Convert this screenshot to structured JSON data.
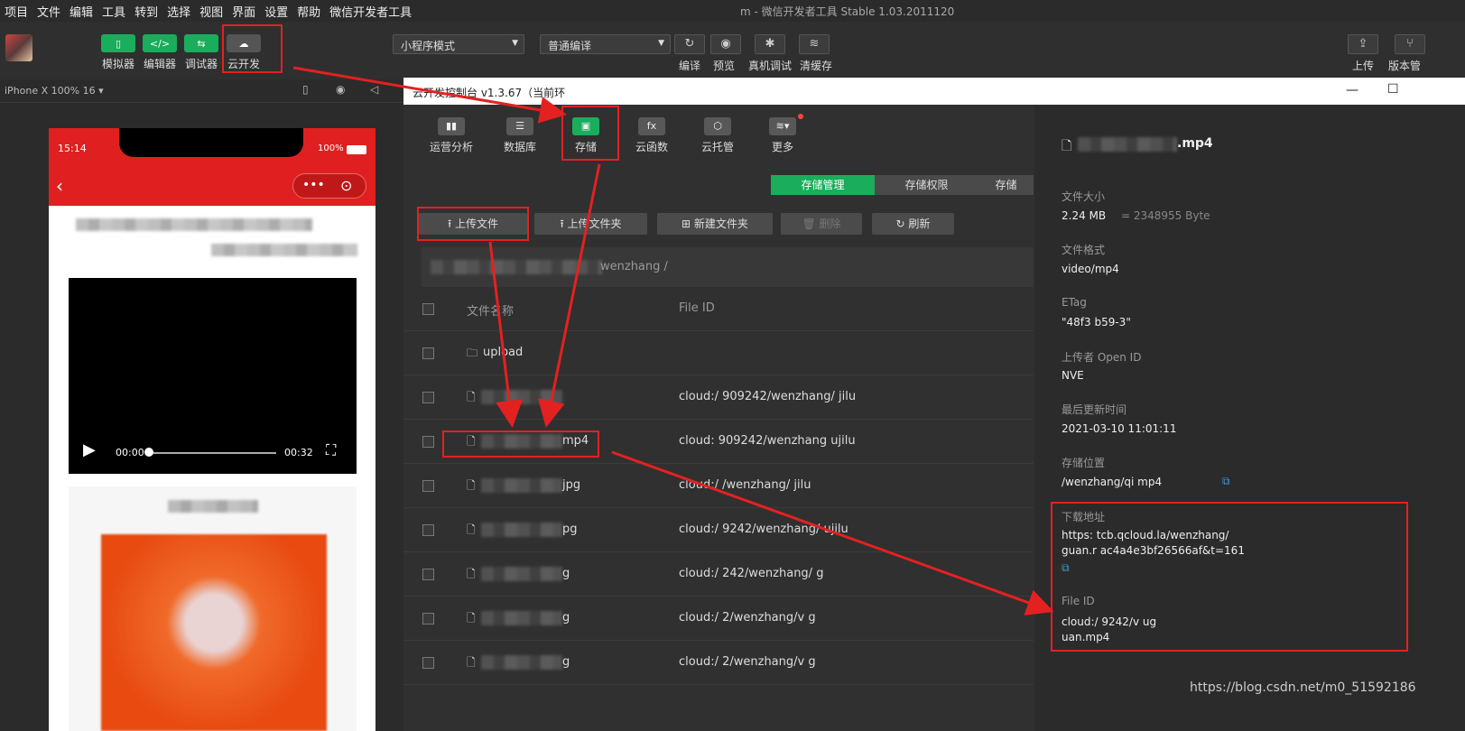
{
  "menu": [
    "项目",
    "文件",
    "编辑",
    "工具",
    "转到",
    "选择",
    "视图",
    "界面",
    "设置",
    "帮助",
    "微信开发者工具"
  ],
  "window_title": "m - 微信开发者工具 Stable 1.03.2011120",
  "toolbar": {
    "simulator": "模拟器",
    "editor": "编辑器",
    "debugger": "调试器",
    "cloud": "云开发",
    "mode": "小程序模式",
    "compile_mode": "普通编译",
    "compile": "编译",
    "preview": "预览",
    "real_debug": "真机调试",
    "clear_cache": "清缓存",
    "upload": "上传",
    "version": "版本管"
  },
  "simbar": {
    "device": "iPhone X 100% 16 ▾"
  },
  "phone": {
    "time": "15:14",
    "battery": "100%",
    "video_time": "00:00",
    "video_duration": "00:32"
  },
  "console": {
    "title": "云开发控制台 v1.3.67（当前环",
    "nav": [
      "运营分析",
      "数据库",
      "存储",
      "云函数",
      "云托管",
      "更多"
    ],
    "tabs": [
      "存储管理",
      "存储权限",
      "存储"
    ],
    "actions": {
      "upload_file": "上传文件",
      "upload_folder": "上传文件夹",
      "new_folder": "新建文件夹",
      "delete": "删除",
      "refresh": "刷新"
    },
    "path": "wenzhang /",
    "columns": {
      "name": "文件名称",
      "fileid": "File ID"
    },
    "rows": [
      {
        "name": "upload",
        "fileid": ""
      },
      {
        "name": "",
        "fileid": "cloud:/ 909242/wenzhang/ jilu"
      },
      {
        "name": "mp4",
        "fileid": "cloud: 909242/wenzhang ujilu"
      },
      {
        "name": "jpg",
        "fileid": "cloud:/ /wenzhang/ jilu"
      },
      {
        "name": "pg",
        "fileid": "cloud:/ 9242/wenzhang/ ujilu"
      },
      {
        "name": "g",
        "fileid": "cloud:/ 242/wenzhang/ g"
      },
      {
        "name": "g",
        "fileid": "cloud:/ 2/wenzhang/v g"
      },
      {
        "name": "g",
        "fileid": "cloud:/ 2/wenzhang/v g"
      }
    ]
  },
  "detail": {
    "filename": ".mp4",
    "size_label": "文件大小",
    "size": "2.24 MB",
    "size_bytes": "= 2348955 Byte",
    "format_label": "文件格式",
    "format": "video/mp4",
    "etag_label": "ETag",
    "etag": "\"48f3 b59-3\"",
    "uploader_label": "上传者 Open ID",
    "uploader": "NVE",
    "updated_label": "最后更新时间",
    "updated": "2021-03-10 11:01:11",
    "location_label": "存储位置",
    "location": "/wenzhang/qi mp4",
    "download_label": "下载地址",
    "download_1": "https: tcb.qcloud.la/wenzhang/",
    "download_2": "guan.r ac4a4e3bf26566af&t=161",
    "fileid_label": "File ID",
    "fileid_1": "cloud:/ 9242/v ug",
    "fileid_2": "uan.mp4"
  },
  "watermark": "https://blog.csdn.net/m0_51592186"
}
